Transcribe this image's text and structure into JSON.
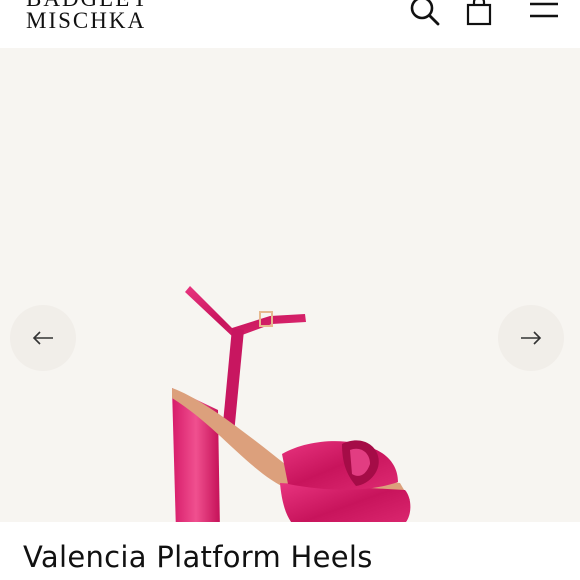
{
  "header": {
    "brand_line1": "BADGLEY",
    "brand_line2": "MISCHKA",
    "icons": [
      "search-icon",
      "shopping-bag-icon",
      "hamburger-menu-icon"
    ]
  },
  "gallery": {
    "prev_icon": "arrow-left-icon",
    "next_icon": "arrow-right-icon",
    "image_subject": "pink satin platform heel sandal"
  },
  "product": {
    "title": "Valencia Platform Heels"
  },
  "colors": {
    "background": "#ffffff",
    "gallery_bg": "#f7f5f1",
    "text": "#111111",
    "product_pink": "#d61b6a"
  }
}
